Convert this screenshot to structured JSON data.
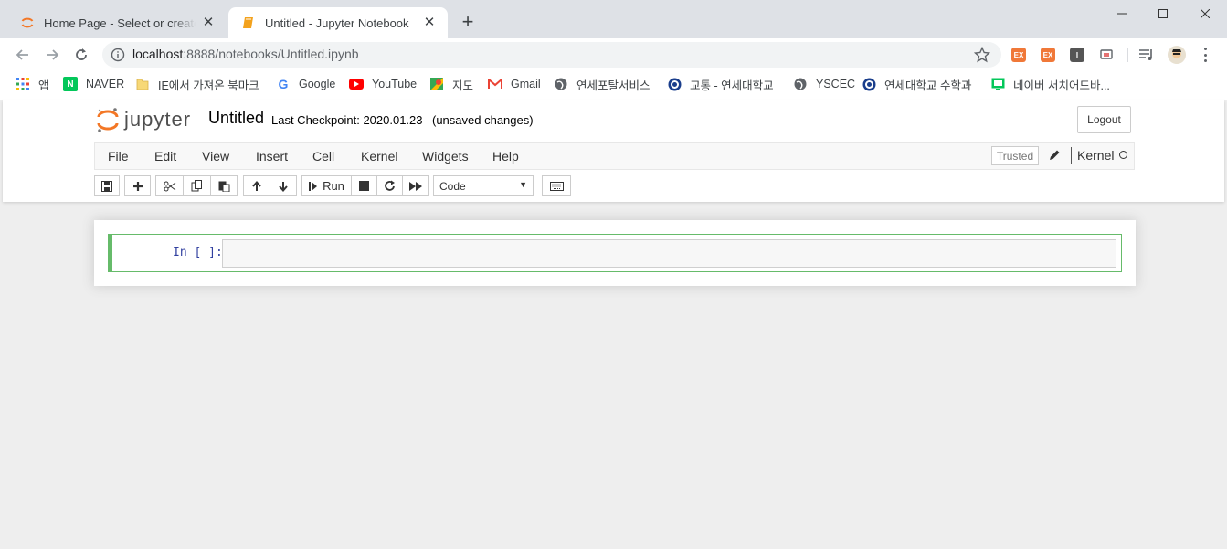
{
  "browser": {
    "tabs": [
      {
        "title": "Home Page - Select or create a notebook",
        "active": false
      },
      {
        "title": "Untitled - Jupyter Notebook",
        "active": true
      }
    ],
    "url_host": "localhost",
    "url_rest": ":8888/notebooks/Untitled.ipynb",
    "extensions": [
      {
        "label": "EX",
        "color": "#f07838"
      },
      {
        "label": "EX",
        "color": "#f07838"
      },
      {
        "label": "I",
        "color": "#555555"
      }
    ]
  },
  "bookmarks": [
    {
      "label": "앱",
      "icon": "apps-icon"
    },
    {
      "label": "NAVER",
      "icon": "naver-icon"
    },
    {
      "label": "IE에서 가져온 북마크",
      "icon": "folder-icon"
    },
    {
      "label": "Google",
      "icon": "google-icon"
    },
    {
      "label": "YouTube",
      "icon": "youtube-icon"
    },
    {
      "label": "지도",
      "icon": "maps-icon"
    },
    {
      "label": "Gmail",
      "icon": "gmail-icon"
    },
    {
      "label": "연세포탈서비스",
      "icon": "globe-icon"
    },
    {
      "label": "교통 - 연세대학교",
      "icon": "yonsei-icon"
    },
    {
      "label": "YSCEC",
      "icon": "globe-icon"
    },
    {
      "label": "연세대학교 수학과",
      "icon": "yonsei-icon"
    },
    {
      "label": "네이버 서치어드바...",
      "icon": "naver-search-icon"
    }
  ],
  "jupyter": {
    "logo_text": "jupyter",
    "notebook_name": "Untitled",
    "checkpoint": "Last Checkpoint: 2020.01.23",
    "autosave": "(unsaved changes)",
    "logout": "Logout",
    "menus": [
      "File",
      "Edit",
      "View",
      "Insert",
      "Cell",
      "Kernel",
      "Widgets",
      "Help"
    ],
    "trusted": "Trusted",
    "kernel": "Kernel",
    "run_label": "Run",
    "cell_type": "Code",
    "cell_prompt": "In [ ]:"
  }
}
